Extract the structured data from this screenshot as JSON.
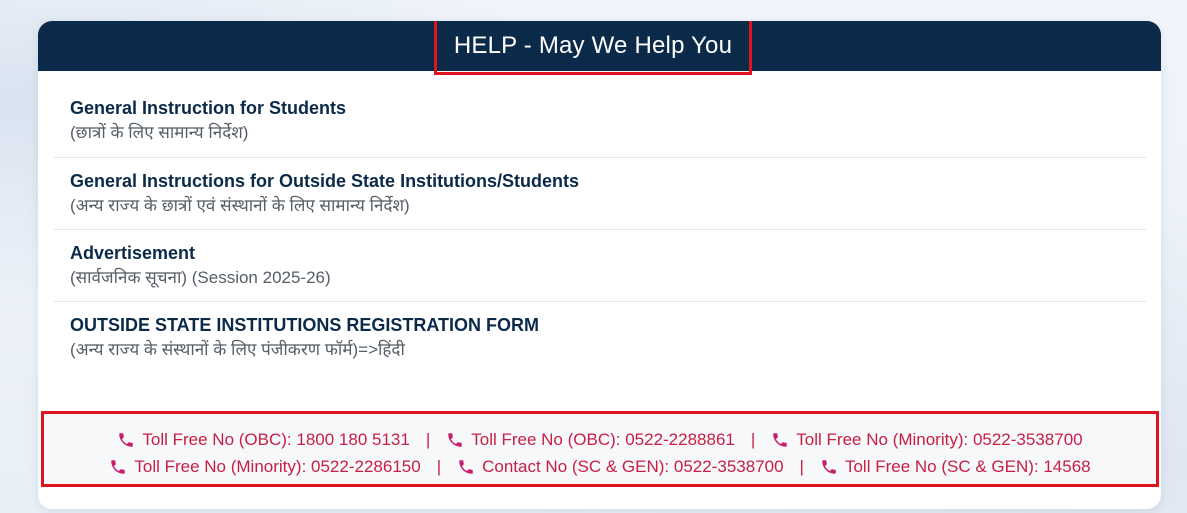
{
  "header": {
    "title": "HELP - May We Help You"
  },
  "items": [
    {
      "title": "General Instruction for Students",
      "subtitle": "(छात्रों के लिए सामान्य निर्देश)"
    },
    {
      "title": "General Instructions for Outside State Institutions/Students",
      "subtitle": "(अन्य राज्य के छात्रों एवं संस्थानों के लिए सामान्य निर्देश)"
    },
    {
      "title": "Advertisement",
      "subtitle": "(सार्वजनिक सूचना) (Session 2025-26)"
    },
    {
      "title": "OUTSIDE STATE INSTITUTIONS REGISTRATION FORM",
      "subtitle": "(अन्य राज्य के संस्थानों के लिए पंजीकरण फॉर्म)=>हिंदी"
    }
  ],
  "contacts": {
    "separator": "|",
    "row1": [
      "Toll Free No (OBC): 1800 180 5131",
      "Toll Free No (OBC): 0522-2288861",
      "Toll Free No (Minority): 0522-3538700"
    ],
    "row2": [
      "Toll Free No (Minority): 0522-2286150",
      "Contact No (SC & GEN): 0522-3538700",
      "Toll Free No (SC & GEN): 14568"
    ],
    "icon": "phone-icon",
    "color": "#c81e45"
  },
  "colors": {
    "header_bg": "#0b2a4a",
    "highlight_border": "#e0141e",
    "title_text": "#0b2a4a"
  }
}
